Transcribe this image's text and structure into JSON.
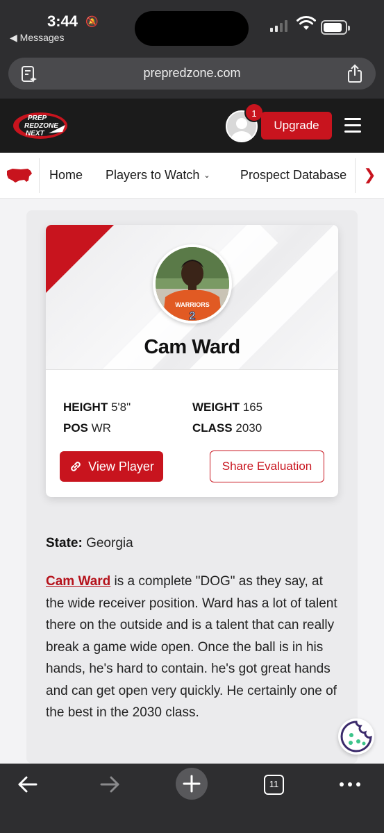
{
  "status_bar": {
    "time": "3:44",
    "back_label": "◀ Messages",
    "battery_level": 0.85,
    "signal_bars": 2
  },
  "browser": {
    "url": "prepredzone.com",
    "tab_count": "11"
  },
  "header": {
    "logo_text": [
      "PREP",
      "REDZONE",
      "NEXT"
    ],
    "notification_count": "1",
    "upgrade_label": "Upgrade"
  },
  "nav": {
    "items": [
      {
        "label": "Home"
      },
      {
        "label": "Players to Watch",
        "has_dropdown": true
      },
      {
        "label": "Prospect Database"
      }
    ],
    "next_icon": "chevron-right"
  },
  "player": {
    "name": "Cam Ward",
    "jersey_text": "WARRIORS",
    "stats": {
      "height_label": "HEIGHT",
      "height": "5'8\"",
      "weight_label": "WEIGHT",
      "weight": "165",
      "pos_label": "POS",
      "pos": "WR",
      "class_label": "CLASS",
      "class": "2030"
    },
    "view_label": "View Player",
    "share_label": "Share Evaluation"
  },
  "evaluation": {
    "state_label": "State:",
    "state": "Georgia",
    "bio_link": "Cam Ward",
    "bio_text": " is a complete \"DOG\" as they say, at the wide receiver position. Ward has a lot of talent there on the outside and is a talent that can really break a game wide open. Once the ball is in his hands, he's hard to contain. he's got great hands and can get open very quickly. He certainly one of the best in the 2030 class."
  },
  "colors": {
    "brand_red": "#c8141e",
    "chrome_dark": "#2e2e30",
    "header_black": "#1b1b1b"
  }
}
